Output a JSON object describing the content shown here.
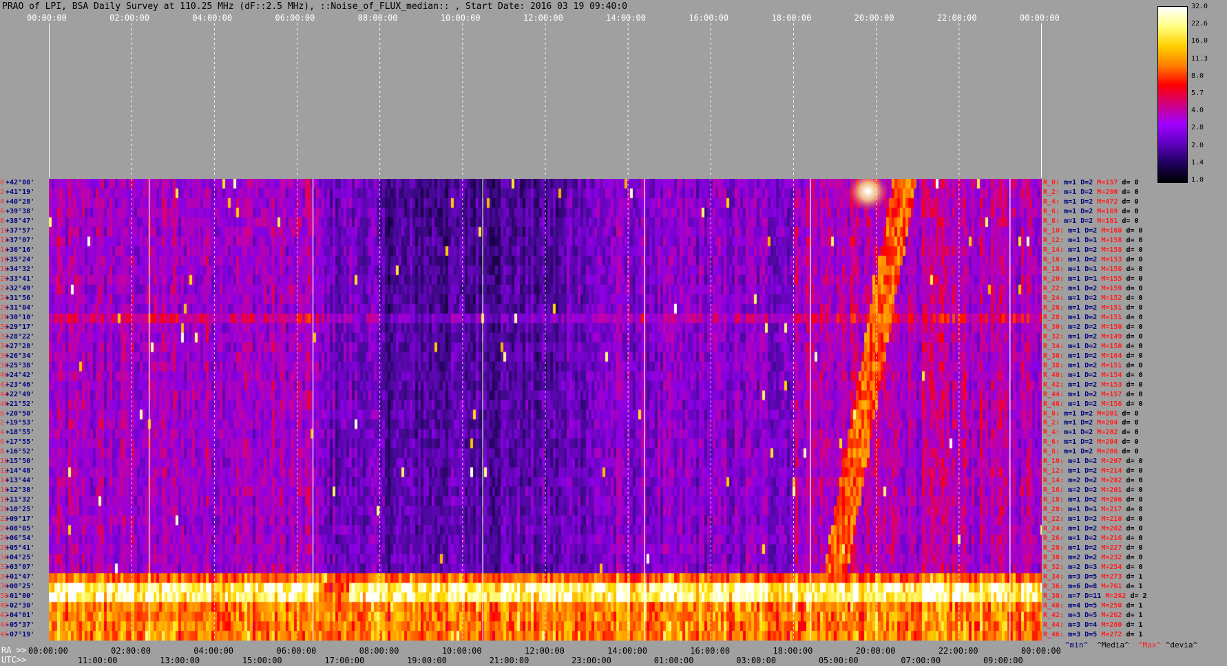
{
  "title": "PRAO of LPI, BSA Daily Survey at 110.25 MHz (dF::2.5 MHz), ::Noise_of_FLUX_median:: , Start Date: 2016 03 19 09:40:0",
  "top_axis_ticks": [
    "00:00:00",
    "02:00:00",
    "04:00:00",
    "06:00:00",
    "08:00:00",
    "10:00:00",
    "12:00:00",
    "14:00:00",
    "16:00:00",
    "18:00:00",
    "20:00:00",
    "22:00:00",
    "00:00:00"
  ],
  "ra_axis": {
    "label": "RA >>",
    "ticks": [
      "00:00:00",
      "02:00:00",
      "04:00:00",
      "06:00:00",
      "08:00:00",
      "10:00:00",
      "12:00:00",
      "14:00:00",
      "16:00:00",
      "18:00:00",
      "20:00:00",
      "22:00:00",
      "00:00:00"
    ]
  },
  "utc_axis": {
    "label": "UTC>>",
    "ticks": [
      "11:00:00",
      "13:00:00",
      "15:00:00",
      "17:00:00",
      "19:00:00",
      "21:00:00",
      "23:00:00",
      "01:00:00",
      "03:00:00",
      "05:00:00",
      "07:00:00",
      "09:00:00"
    ]
  },
  "declinations": [
    {
      "i": "0",
      "d": "+42°08'"
    },
    {
      "i": "2",
      "d": "+41°19'"
    },
    {
      "i": "4",
      "d": "+40°28'"
    },
    {
      "i": "6",
      "d": "+39°38'"
    },
    {
      "i": "8",
      "d": "+38°47'"
    },
    {
      "i": "10",
      "d": "+37°57'"
    },
    {
      "i": "12",
      "d": "+37°07'"
    },
    {
      "i": "14",
      "d": "+36°16'"
    },
    {
      "i": "16",
      "d": "+35°24'"
    },
    {
      "i": "18",
      "d": "+34°32'"
    },
    {
      "i": "20",
      "d": "+33°41'"
    },
    {
      "i": "22",
      "d": "+32°49'"
    },
    {
      "i": "24",
      "d": "+31°56'"
    },
    {
      "i": "26",
      "d": "+31°04'"
    },
    {
      "i": "28",
      "d": "+30°10'"
    },
    {
      "i": "30",
      "d": "+29°17'"
    },
    {
      "i": "32",
      "d": "+28°22'"
    },
    {
      "i": "34",
      "d": "+27°28'"
    },
    {
      "i": "36",
      "d": "+26°34'"
    },
    {
      "i": "38",
      "d": "+25°38'"
    },
    {
      "i": "40",
      "d": "+24°42'"
    },
    {
      "i": "42",
      "d": "+23°46'"
    },
    {
      "i": "44",
      "d": "+22°49'"
    },
    {
      "i": "46",
      "d": "+21°52'"
    },
    {
      "i": "0",
      "d": "+20°50'"
    },
    {
      "i": "2",
      "d": "+19°53'"
    },
    {
      "i": "4",
      "d": "+18°55'"
    },
    {
      "i": "6",
      "d": "+17°55'"
    },
    {
      "i": "8",
      "d": "+16°52'"
    },
    {
      "i": "10",
      "d": "+15°50'"
    },
    {
      "i": "12",
      "d": "+14°48'"
    },
    {
      "i": "14",
      "d": "+13°44'"
    },
    {
      "i": "16",
      "d": "+12°38'"
    },
    {
      "i": "18",
      "d": "+11°32'"
    },
    {
      "i": "20",
      "d": "+10°25'"
    },
    {
      "i": "22",
      "d": "+09°17'"
    },
    {
      "i": "24",
      "d": "+08°05'"
    },
    {
      "i": "26",
      "d": "+06°54'"
    },
    {
      "i": "28",
      "d": "+05°41'"
    },
    {
      "i": "30",
      "d": "+04°25'"
    },
    {
      "i": "32",
      "d": "+03°07'"
    },
    {
      "i": "34",
      "d": "+01°47'"
    },
    {
      "i": "36",
      "d": "+00°25'"
    },
    {
      "i": "38",
      "d": "-01°00'"
    },
    {
      "i": "40",
      "d": "-02°30'"
    },
    {
      "i": "42",
      "d": "-04°01'"
    },
    {
      "i": "44",
      "d": "-05°37'"
    },
    {
      "i": "46",
      "d": "-07°19'"
    }
  ],
  "row_stats": [
    {
      "r": "R_0:",
      "m": "m=1",
      "D": "D=2",
      "M": "M=157",
      "d": "d= 0"
    },
    {
      "r": "R_2:",
      "m": "m=1",
      "D": "D=2",
      "M": "M=200",
      "d": "d= 0"
    },
    {
      "r": "R_4:",
      "m": "m=1",
      "D": "D=2",
      "M": "M=472",
      "d": "d= 0"
    },
    {
      "r": "R_6:",
      "m": "m=1",
      "D": "D=2",
      "M": "M=169",
      "d": "d= 0"
    },
    {
      "r": "R_8:",
      "m": "m=1",
      "D": "D=2",
      "M": "M=161",
      "d": "d= 0"
    },
    {
      "r": "R_10:",
      "m": "m=1",
      "D": "D=2",
      "M": "M=160",
      "d": "d= 0"
    },
    {
      "r": "R_12:",
      "m": "m=1",
      "D": "D=1",
      "M": "M=158",
      "d": "d= 0"
    },
    {
      "r": "R_14:",
      "m": "m=1",
      "D": "D=2",
      "M": "M=158",
      "d": "d= 0"
    },
    {
      "r": "R_16:",
      "m": "m=1",
      "D": "D=2",
      "M": "M=153",
      "d": "d= 0"
    },
    {
      "r": "R_18:",
      "m": "m=1",
      "D": "D=1",
      "M": "M=156",
      "d": "d= 0"
    },
    {
      "r": "R_20:",
      "m": "m=1",
      "D": "D=1",
      "M": "M=155",
      "d": "d= 0"
    },
    {
      "r": "R_22:",
      "m": "m=1",
      "D": "D=2",
      "M": "M=159",
      "d": "d= 0"
    },
    {
      "r": "R_24:",
      "m": "m=1",
      "D": "D=2",
      "M": "M=152",
      "d": "d= 0"
    },
    {
      "r": "R_26:",
      "m": "m=1",
      "D": "D=2",
      "M": "M=151",
      "d": "d= 0"
    },
    {
      "r": "R_28:",
      "m": "m=1",
      "D": "D=2",
      "M": "M=151",
      "d": "d= 0"
    },
    {
      "r": "R_30:",
      "m": "m=2",
      "D": "D=2",
      "M": "M=150",
      "d": "d= 0"
    },
    {
      "r": "R_32:",
      "m": "m=1",
      "D": "D=2",
      "M": "M=149",
      "d": "d= 0"
    },
    {
      "r": "R_34:",
      "m": "m=1",
      "D": "D=2",
      "M": "M=150",
      "d": "d= 0"
    },
    {
      "r": "R_36:",
      "m": "m=1",
      "D": "D=2",
      "M": "M=164",
      "d": "d= 0"
    },
    {
      "r": "R_38:",
      "m": "m=1",
      "D": "D=2",
      "M": "M=151",
      "d": "d= 0"
    },
    {
      "r": "R_40:",
      "m": "m=1",
      "D": "D=2",
      "M": "M=154",
      "d": "d= 0"
    },
    {
      "r": "R_42:",
      "m": "m=1",
      "D": "D=2",
      "M": "M=153",
      "d": "d= 0"
    },
    {
      "r": "R_44:",
      "m": "m=1",
      "D": "D=2",
      "M": "M=157",
      "d": "d= 0"
    },
    {
      "r": "R_46:",
      "m": "m=1",
      "D": "D=2",
      "M": "M=156",
      "d": "d= 0"
    },
    {
      "r": "R_0:",
      "m": "m=1",
      "D": "D=2",
      "M": "M=201",
      "d": "d= 0"
    },
    {
      "r": "R_2:",
      "m": "m=1",
      "D": "D=2",
      "M": "M=204",
      "d": "d= 0"
    },
    {
      "r": "R_4:",
      "m": "m=1",
      "D": "D=2",
      "M": "M=202",
      "d": "d= 0"
    },
    {
      "r": "R_6:",
      "m": "m=1",
      "D": "D=2",
      "M": "M=204",
      "d": "d= 0"
    },
    {
      "r": "R_8:",
      "m": "m=1",
      "D": "D=2",
      "M": "M=206",
      "d": "d= 0"
    },
    {
      "r": "R_10:",
      "m": "m=1",
      "D": "D=2",
      "M": "M=207",
      "d": "d= 0"
    },
    {
      "r": "R_12:",
      "m": "m=1",
      "D": "D=2",
      "M": "M=214",
      "d": "d= 0"
    },
    {
      "r": "R_14:",
      "m": "m=2",
      "D": "D=2",
      "M": "M=202",
      "d": "d= 0"
    },
    {
      "r": "R_16:",
      "m": "m=2",
      "D": "D=2",
      "M": "M=201",
      "d": "d= 0"
    },
    {
      "r": "R_18:",
      "m": "m=1",
      "D": "D=2",
      "M": "M=206",
      "d": "d= 0"
    },
    {
      "r": "R_20:",
      "m": "m=1",
      "D": "D=1",
      "M": "M=217",
      "d": "d= 0"
    },
    {
      "r": "R_22:",
      "m": "m=1",
      "D": "D=2",
      "M": "M=210",
      "d": "d= 0"
    },
    {
      "r": "R_24:",
      "m": "m=1",
      "D": "D=2",
      "M": "M=202",
      "d": "d= 0"
    },
    {
      "r": "R_26:",
      "m": "m=1",
      "D": "D=2",
      "M": "M=216",
      "d": "d= 0"
    },
    {
      "r": "R_28:",
      "m": "m=1",
      "D": "D=2",
      "M": "M=227",
      "d": "d= 0"
    },
    {
      "r": "R_30:",
      "m": "m=2",
      "D": "D=2",
      "M": "M=232",
      "d": "d= 0"
    },
    {
      "r": "R_32:",
      "m": "m=2",
      "D": "D=3",
      "M": "M=254",
      "d": "d= 0"
    },
    {
      "r": "R_34:",
      "m": "m=3",
      "D": "D=5",
      "M": "M=273",
      "d": "d= 1"
    },
    {
      "r": "R_36:",
      "m": "m=6",
      "D": "D=8",
      "M": "M=761",
      "d": "d= 1"
    },
    {
      "r": "R_38:",
      "m": "m=7",
      "D": "D=11",
      "M": "M=262",
      "d": "d= 2"
    },
    {
      "r": "R_40:",
      "m": "m=4",
      "D": "D=5",
      "M": "M=250",
      "d": "d= 1"
    },
    {
      "r": "R_42:",
      "m": "m=3",
      "D": "D=5",
      "M": "M=262",
      "d": "d= 1"
    },
    {
      "r": "R_44:",
      "m": "m=3",
      "D": "D=4",
      "M": "M=260",
      "d": "d= 1"
    },
    {
      "r": "R_46:",
      "m": "m=3",
      "D": "D=5",
      "M": "M=272",
      "d": "d= 1"
    }
  ],
  "stats_legend": {
    "min": "^min^",
    "media": "^Media^",
    "max": "^Max^",
    "devia": "^devia^"
  },
  "colorbar": {
    "ticks": [
      "32.0",
      "22.6",
      "16.0",
      "11.3",
      "8.0",
      "5.7",
      "4.0",
      "2.8",
      "2.0",
      "1.4",
      "1.0"
    ],
    "colors": [
      "#ffffff",
      "#ffff80",
      "#ffd000",
      "#ff8000",
      "#ff0000",
      "#d00080",
      "#a000ff",
      "#6000c0",
      "#200060",
      "#000000"
    ]
  },
  "chart_data": {
    "type": "heatmap",
    "title": "PRAO of LPI, BSA Daily Survey at 110.25 MHz (dF::2.5 MHz), ::Noise_of_FLUX_median:: , Start Date: 2016 03 19 09:40:0",
    "x_ticks_ra": [
      "00:00:00",
      "02:00:00",
      "04:00:00",
      "06:00:00",
      "08:00:00",
      "10:00:00",
      "12:00:00",
      "14:00:00",
      "16:00:00",
      "18:00:00",
      "20:00:00",
      "22:00:00",
      "00:00:00"
    ],
    "x_ticks_utc": [
      "11:00:00",
      "13:00:00",
      "15:00:00",
      "17:00:00",
      "19:00:00",
      "21:00:00",
      "23:00:00",
      "01:00:00",
      "03:00:00",
      "05:00:00",
      "07:00:00",
      "09:00:00"
    ],
    "y_ticks": [
      "+42°08'",
      "-07°19'"
    ],
    "color_range": [
      1.0,
      32.0
    ],
    "color_scale": "log"
  }
}
